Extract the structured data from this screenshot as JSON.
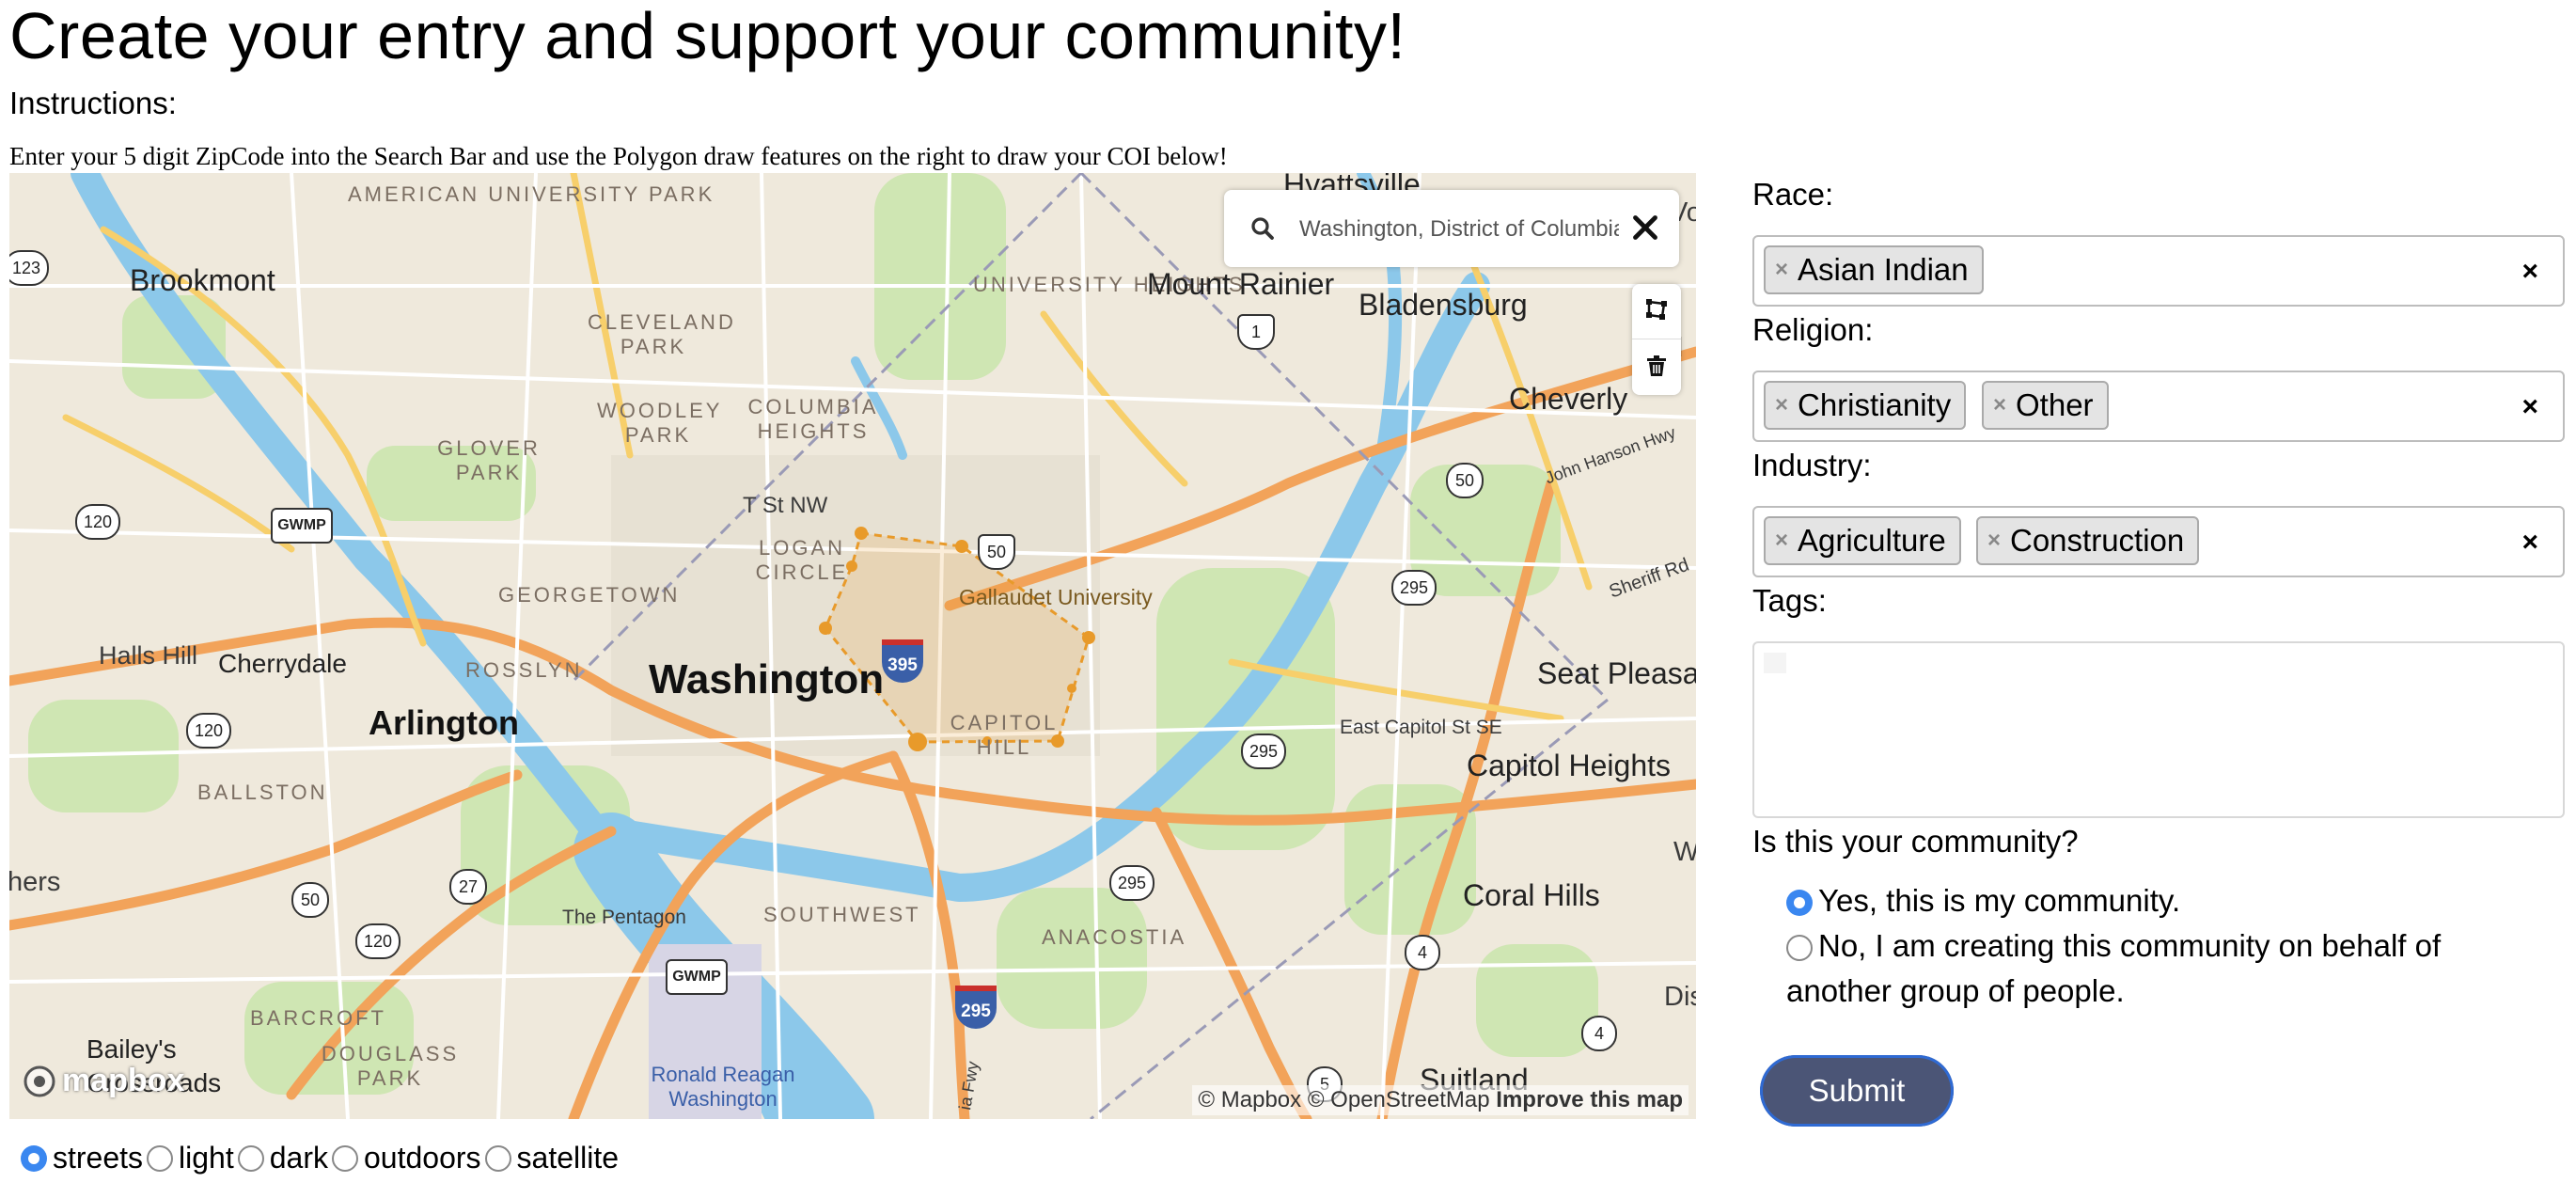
{
  "page": {
    "title": "Create your entry and support your community!",
    "instructions_heading": "Instructions:",
    "instructions_text": "Enter your 5 digit ZipCode into the Search Bar and use the Polygon draw features on the right to draw your COI below!"
  },
  "map": {
    "search": {
      "value": "Washington, District of Columbia",
      "icon": "search-icon",
      "clear_icon": "close-icon"
    },
    "draw_controls": [
      {
        "name": "polygon-tool-icon"
      },
      {
        "name": "trash-icon"
      }
    ],
    "logo_text": "mapbox",
    "attribution": {
      "mapbox": "© Mapbox",
      "osm": "© OpenStreetMap",
      "improve": "Improve this map"
    },
    "labels": {
      "american_university_park": "AMERICAN UNIVERSITY PARK",
      "hyattsville": "Hyattsville",
      "brookmont": "Brookmont",
      "university_heights": "UNIVERSITY HEIGHTS",
      "mount_rainier": "Mount Rainier",
      "bladensburg": "Bladensburg",
      "cleveland_park": "CLEVELAND PARK",
      "woodley_park": "WOODLEY PARK",
      "columbia_heights": "COLUMBIA HEIGHTS",
      "cheverly": "Cheverly",
      "glover_park": "GLOVER PARK",
      "t_st_nw": "T St NW",
      "logan_circle": "LOGAN CIRCLE",
      "gallaudet": "Gallaudet University",
      "georgetown": "GEORGETOWN",
      "john_hanson": "John Hanson Hwy",
      "sheriff_rd": "Sheriff Rd",
      "halls_hill": "Halls Hill",
      "cherrydale": "Cherrydale",
      "rosslyn": "ROSSLYN",
      "washington": "Washington",
      "seat_pleasant": "Seat Pleasan",
      "arlington": "Arlington",
      "capitol_hill": "CAPITOL HILL",
      "east_capitol": "East Capitol St SE",
      "capitol_heights": "Capitol Heights",
      "ballston": "BALLSTON",
      "pentagon": "The Pentagon",
      "southwest": "SOUTHWEST",
      "coral_hills": "Coral Hills",
      "anacostia": "ANACOSTIA",
      "barcroft": "BARCROFT",
      "douglass_park": "DOUGLASS PARK",
      "baileys": "Bailey's Crossroads",
      "reagan": "Ronald Reagan Washington",
      "suitland": "Suitland",
      "district": "Distr",
      "w": "W",
      "d": "d",
      "vo": "Vo",
      "hers": "hers",
      "fwy": "ia Fwy"
    },
    "shields": [
      "123",
      "120",
      "GWMP",
      "120",
      "120",
      "27",
      "50",
      "120",
      "GWMP",
      "295",
      "295",
      "295",
      "4",
      "4",
      "5",
      "50",
      "1",
      "50",
      "395",
      "295",
      "50"
    ]
  },
  "map_styles": {
    "selected": "streets",
    "options": [
      "streets",
      "light",
      "dark",
      "outdoors",
      "satellite"
    ]
  },
  "form": {
    "race_label": "Race:",
    "race_values": [
      "Asian Indian"
    ],
    "religion_label": "Religion:",
    "religion_values": [
      "Christianity",
      "Other"
    ],
    "industry_label": "Industry:",
    "industry_values": [
      "Agriculture",
      "Construction"
    ],
    "tags_label": "Tags:",
    "question": "Is this your community?",
    "option_yes": "Yes, this is my community.",
    "option_no": "No, I am creating this community on behalf of another group of people.",
    "selected_option": "yes",
    "submit_label": "Submit",
    "chip_remove": "×",
    "clear_all": "×"
  },
  "colors": {
    "water": "#8cc8ea",
    "park": "#cfe6b3",
    "road_major": "#f2a35a",
    "submit_bg": "#4b5576",
    "radio_selected": "#3a87f0",
    "polygon": "#e89a2a"
  }
}
